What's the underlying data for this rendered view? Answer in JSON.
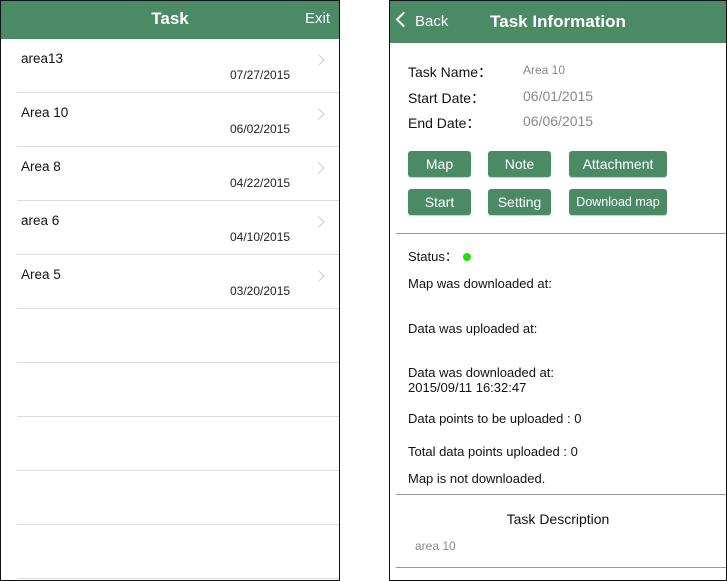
{
  "left": {
    "title": "Task",
    "exit_label": "Exit",
    "tasks": [
      {
        "name": "area13",
        "date": "07/27/2015"
      },
      {
        "name": "Area 10",
        "date": "06/02/2015"
      },
      {
        "name": "Area 8",
        "date": "04/22/2015"
      },
      {
        "name": "area 6",
        "date": "04/10/2015"
      },
      {
        "name": "Area 5",
        "date": "03/20/2015"
      }
    ]
  },
  "right": {
    "back_label": "Back",
    "title": "Task Information",
    "task_name_label": "Task Name：",
    "task_name_value": "Area 10",
    "start_date_label": "Start Date：",
    "start_date_value": "06/01/2015",
    "end_date_label": "End Date：",
    "end_date_value": "06/06/2015",
    "buttons": {
      "map": "Map",
      "note": "Note",
      "attachment": "Attachment",
      "start": "Start",
      "setting": "Setting",
      "download_map": "Download map"
    },
    "status_label": "Status：",
    "status_color": "#22e000",
    "map_downloaded_at": "Map was downloaded at:",
    "data_uploaded_at": "Data was uploaded at:",
    "data_downloaded_at": "Data was downloaded at:",
    "data_downloaded_value": "2015/09/11 16:32:47",
    "points_to_upload": "Data points to be uploaded : 0",
    "total_uploaded": "Total data points uploaded : 0",
    "map_not_downloaded": "Map is not downloaded.",
    "description_title": "Task Description",
    "description_value": "area 10"
  },
  "colors": {
    "accent": "#4a8a64",
    "status_ok": "#22e000"
  }
}
